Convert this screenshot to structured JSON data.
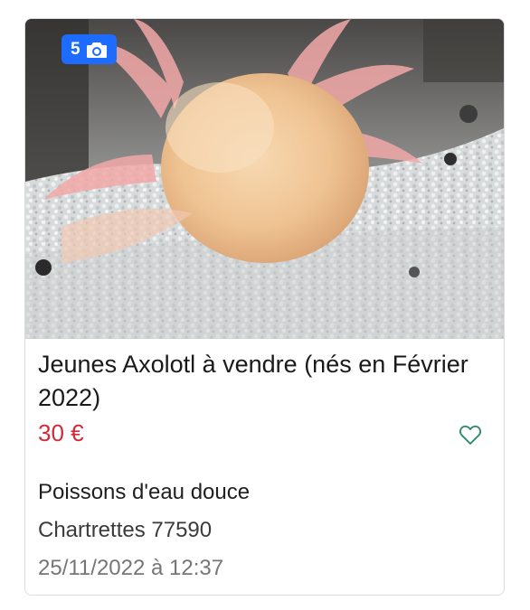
{
  "listing": {
    "photo_count": "5",
    "photo_icon": "camera-icon",
    "title": "Jeunes Axolotl à vendre (nés en Février 2022)",
    "price": "30 €",
    "favorite_icon": "heart-outline-icon",
    "category": "Poissons d'eau douce",
    "location": "Chartrettes 77590",
    "date": "25/11/2022 à 12:37"
  },
  "colors": {
    "badge_bg": "#1e6bff",
    "price": "#d12b3a",
    "favorite": "#2e8b6d",
    "date_text": "#767676"
  }
}
